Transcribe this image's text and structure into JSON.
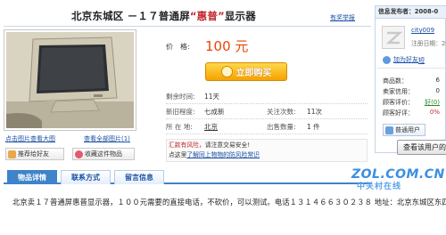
{
  "title": {
    "text": "北京东城区 －１７普通屏",
    "quoted": "“惠普”",
    "suffix": "显示器"
  },
  "compare_link": "有奖举报",
  "gallery": {
    "enlarge_link": "点击图片查看大图",
    "view_all_link": "查看全部图片(1)",
    "recommend_button": "推荐给好友",
    "favorite_button": "收藏这件物品"
  },
  "price": {
    "label": "价　格:",
    "value": "100 元"
  },
  "buy_button": "立即购买",
  "details": [
    {
      "k1": "剩余时间:",
      "v1": "11天",
      "k2": "",
      "v2": ""
    },
    {
      "k1": "新旧程度:",
      "v1": "七成新",
      "k2": "关注次数:",
      "v2": "11次"
    },
    {
      "k1": "所 在 地:",
      "v1": "北京",
      "k2": "出售数量:",
      "v2": "1 件"
    }
  ],
  "notice": {
    "line1_red": "汇款有风险，",
    "line1": "请注意交易安全!",
    "line2_prefix": "点这里",
    "line2_link": "了解同上物物的防风险常识"
  },
  "tabs": [
    "物品详情",
    "联系方式",
    "留言信息"
  ],
  "description": "北京卖１７普通屏惠普显示器，１００元需要的直接电话，不砍价，可以测试。电话１３１４６６３０２３８ 地址：北京东城区东四十",
  "seller": {
    "header": "信息发布者：2008-0",
    "username": "city009",
    "reg_time": "注册日期：200",
    "favorite_label": "加为好友",
    "favorite_label2": "短",
    "stats": [
      {
        "label": "商品数：",
        "value": "6"
      },
      {
        "label": "卖家信用：",
        "value": "0"
      },
      {
        "label": "顾客评价：",
        "value": "好(0)"
      },
      {
        "label": "顾客好评：",
        "value": "0%"
      }
    ],
    "user_type": "普通用户",
    "check_button": "查看该用户的"
  },
  "watermark": {
    "brand": "ZOL.COM.CN",
    "sub": "中关村在线"
  },
  "colors": {
    "price": "#e8450a",
    "link": "#1a4fa3",
    "tab_active": "#3f83c9",
    "buy": "#f5a200"
  }
}
